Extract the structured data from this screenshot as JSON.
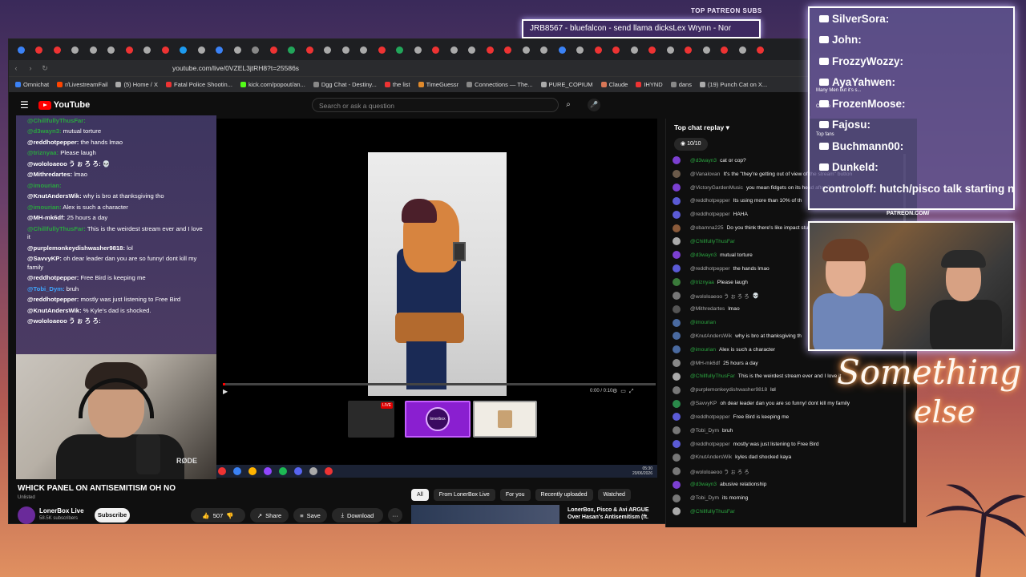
{
  "overlay": {
    "alert_text": "JRB8567 - bluefalcon - send llama dicksLex Wrynn - Nor",
    "patreon_label": "TOP PATREON SUBS",
    "patreon_names": [
      "SilverSora:",
      "John:",
      "FrozzyWozzy:",
      "AyaYahwen:",
      "FrozenMoose:",
      "Fajosu:",
      "Buchmann00:",
      "Dunkeld:",
      "controloff: hutch/pisco talk starting now $$$"
    ],
    "patreon_extra_1": "Many Men but it's s...",
    "patreon_extra_2": "Create",
    "patreon_extra_3": "Top fans",
    "patreon_url": "PATREON.COM/",
    "neon_line1": "Something",
    "neon_line2": "else"
  },
  "browser": {
    "url": "youtube.com/live/0VZEL3jtRH8?t=25586s",
    "bookmarks": [
      {
        "label": "Omnichat",
        "color": "#3b82f6"
      },
      {
        "label": "r/LivestreamFail",
        "color": "#ff4500"
      },
      {
        "label": "(5) Home / X",
        "color": "#aaa"
      },
      {
        "label": "Fatal Police Shootin...",
        "color": "#e33"
      },
      {
        "label": "kick.com/popout/an...",
        "color": "#53fc18"
      },
      {
        "label": "Dgg Chat - Destiny...",
        "color": "#888"
      },
      {
        "label": "the list",
        "color": "#e33"
      },
      {
        "label": "TimeGuessr",
        "color": "#e08a2c"
      },
      {
        "label": "Connections — The...",
        "color": "#888"
      },
      {
        "label": "PURE_COPIUM",
        "color": "#aaa"
      },
      {
        "label": "Claude",
        "color": "#d97757"
      },
      {
        "label": "IHYND",
        "color": "#e33"
      },
      {
        "label": "dans",
        "color": "#888"
      },
      {
        "label": "(19) Punch Cat on X...",
        "color": "#aaa"
      }
    ],
    "tab_colors": [
      "#3b82f6",
      "#e33",
      "#e33",
      "#aaa",
      "#aaa",
      "#aaa",
      "#e33",
      "#aaa",
      "#e33",
      "#1d9bf0",
      "#aaa",
      "#3b82f6",
      "#aaa",
      "#888",
      "#e33",
      "#22a55a",
      "#e33",
      "#aaa",
      "#aaa",
      "#aaa",
      "#e33",
      "#22a55a",
      "#aaa",
      "#e33",
      "#aaa",
      "#aaa",
      "#e33",
      "#e33",
      "#aaa",
      "#aaa",
      "#3b82f6",
      "#aaa",
      "#e33",
      "#e33",
      "#aaa",
      "#e33",
      "#aaa",
      "#e33",
      "#aaa",
      "#e33",
      "#aaa",
      "#e33"
    ]
  },
  "youtube": {
    "search_placeholder": "Search or ask a question",
    "logo_text": "YouTube",
    "video_title": "WHICK PANEL ON ANTISEMITISM OH NO",
    "unlisted": "Unlisted",
    "channel_name": "LonerBox Live",
    "subscribers": "58.5K subscribers",
    "subscribe_label": "Subscribe",
    "like_count": "507",
    "share_label": "Share",
    "save_label": "Save",
    "download_label": "Download",
    "more_label": "···",
    "filters": [
      "All",
      "From LonerBox Live",
      "For you",
      "Recently uploaded",
      "Watched"
    ],
    "rec_title": "LonerBox, Pisco & Avi ARGUE Over Hasan's Antisemitism (ft.",
    "time_text": "0:00 / 0:10",
    "thumb1_live": "LIVE",
    "thumb2_text": "lonerbox",
    "progress": 0.005,
    "tray_time": "05:30",
    "tray_date": "20/06/2026"
  },
  "left_chat": [
    {
      "user": "@ChillfullyThusFar:",
      "text": "",
      "color": "#2ba640"
    },
    {
      "user": "@d3wayn3:",
      "text": "mutual torture",
      "color": "#2ba640"
    },
    {
      "user": "@reddhotpepper:",
      "text": "the hands lmao",
      "color": "#fff"
    },
    {
      "user": "@triznyaa:",
      "text": "Please laugh",
      "color": "#2ba640"
    },
    {
      "user": "@wololoaeoo う ぉ ろ ろ:",
      "text": "💀",
      "color": "#fff"
    },
    {
      "user": "@Mithredartes:",
      "text": "lmao",
      "color": "#fff"
    },
    {
      "user": "@imourian:",
      "text": "",
      "color": "#2ba640"
    },
    {
      "user": "@KnutAndersWik:",
      "text": "why is bro at thanksgiving tho",
      "color": "#fff"
    },
    {
      "user": "@imourian:",
      "text": "Alex is such a character",
      "color": "#2ba640"
    },
    {
      "user": "@MH-mk6df:",
      "text": "25 hours a day",
      "color": "#fff"
    },
    {
      "user": "@ChillfullyThusFar:",
      "text": "This is the weirdest stream ever and I love it",
      "color": "#2ba640"
    },
    {
      "user": "@purplemonkeydishwasher9818:",
      "text": "lol",
      "color": "#fff"
    },
    {
      "user": "@SavvyKP:",
      "text": "oh dear leader dan you are so funny! dont kill my family",
      "color": "#fff"
    },
    {
      "user": "@reddhotpepper:",
      "text": "Free Bird is keeping me",
      "color": "#fff"
    },
    {
      "user": "@Tobi_Dym:",
      "text": "bruh",
      "color": "#3ea6ff"
    },
    {
      "user": "@reddhotpepper:",
      "text": "mostly was just listening to Free Bird",
      "color": "#fff"
    },
    {
      "user": "@KnutAndersWik:",
      "text": "% Kyle's dad is shocked.",
      "color": "#fff"
    },
    {
      "user": "@wololoaeoo う ぉ ろ ろ:",
      "text": "",
      "color": "#fff"
    }
  ],
  "right_chat": {
    "header": "Top chat replay",
    "viewers": "10/10",
    "messages": [
      {
        "user": "@d3wayn3",
        "text": "cat or cop?",
        "member": true,
        "color": "#7b3fd1"
      },
      {
        "user": "@Vanalovan",
        "text": "It's the \"they're getting out of view of the stream\" button",
        "member": false,
        "color": "#6b5a4a"
      },
      {
        "user": "@VictoryGardenMusic",
        "text": "you mean fidgets on its head after 3 hours",
        "member": false,
        "color": "#7b3fd1"
      },
      {
        "user": "@reddhotpepper",
        "text": "Its using more than 10% of th",
        "member": false,
        "color": "#5b5bd6"
      },
      {
        "user": "@reddhotpepper",
        "text": "HAHA",
        "member": false,
        "color": "#5b5bd6"
      },
      {
        "user": "@obamna225",
        "text": "Do you think there's like impact stuff like a cartoon when he blasts her with the",
        "member": false,
        "color": "#8a5a3a"
      },
      {
        "user": "@ChillfullyThusFar",
        "text": "",
        "member": true,
        "color": "#aaa"
      },
      {
        "user": "@d3wayn3",
        "text": "mutual torture",
        "member": true,
        "color": "#7b3fd1"
      },
      {
        "user": "@reddhotpepper",
        "text": "the hands lmao",
        "member": false,
        "color": "#5b5bd6"
      },
      {
        "user": "@triznyaa",
        "text": "Please laugh",
        "member": true,
        "color": "#3a7a3a"
      },
      {
        "user": "@wololoaeoo う ぉ ろ ろ",
        "text": "💀",
        "member": false,
        "color": "#777"
      },
      {
        "user": "@Mithredartes",
        "text": "lmao",
        "member": false,
        "color": "#555"
      },
      {
        "user": "@imourian",
        "text": "",
        "member": true,
        "color": "#4a6aa0"
      },
      {
        "user": "@KnutAndersWik",
        "text": "why is bro at thanksgiving th",
        "member": false,
        "color": "#4a6aa0"
      },
      {
        "user": "@imourian",
        "text": "Alex is such a character",
        "member": true,
        "color": "#4a6aa0"
      },
      {
        "user": "@MH-mk6df",
        "text": "25 hours a day",
        "member": false,
        "color": "#888"
      },
      {
        "user": "@ChillfullyThusFar",
        "text": "This is the weirdest stream ever and I love it",
        "member": true,
        "color": "#aaa"
      },
      {
        "user": "@purplemonkeydishwasher9818",
        "text": "lol",
        "member": false,
        "color": "#777"
      },
      {
        "user": "@SavvyKP",
        "text": "oh dear leader dan you are so funny! dont kill my family",
        "member": false,
        "color": "#2a8a4a"
      },
      {
        "user": "@reddhotpepper",
        "text": "Free Bird is keeping me",
        "member": false,
        "color": "#5b5bd6"
      },
      {
        "user": "@Tobi_Dym",
        "text": "bruh",
        "member": false,
        "color": "#777"
      },
      {
        "user": "@reddhotpepper",
        "text": "mostly was just listening to Free Bird",
        "member": false,
        "color": "#5b5bd6"
      },
      {
        "user": "@KnutAndersWik",
        "text": "kyles dad shocked kaya",
        "member": false,
        "color": "#777"
      },
      {
        "user": "@wololoaeoo う ぉ ろ ろ",
        "text": "",
        "member": false,
        "color": "#777"
      },
      {
        "user": "@d3wayn3",
        "text": "abusive relationship",
        "member": true,
        "color": "#7b3fd1"
      },
      {
        "user": "@Tobi_Dym",
        "text": "its morning",
        "member": false,
        "color": "#777"
      },
      {
        "user": "@ChillfullyThusFar",
        "text": "",
        "member": true,
        "color": "#aaa"
      }
    ]
  },
  "colors": {
    "alert_glow": "#b7a9ff",
    "neon": "#ff8a3d",
    "yt_red": "#ff0000"
  }
}
